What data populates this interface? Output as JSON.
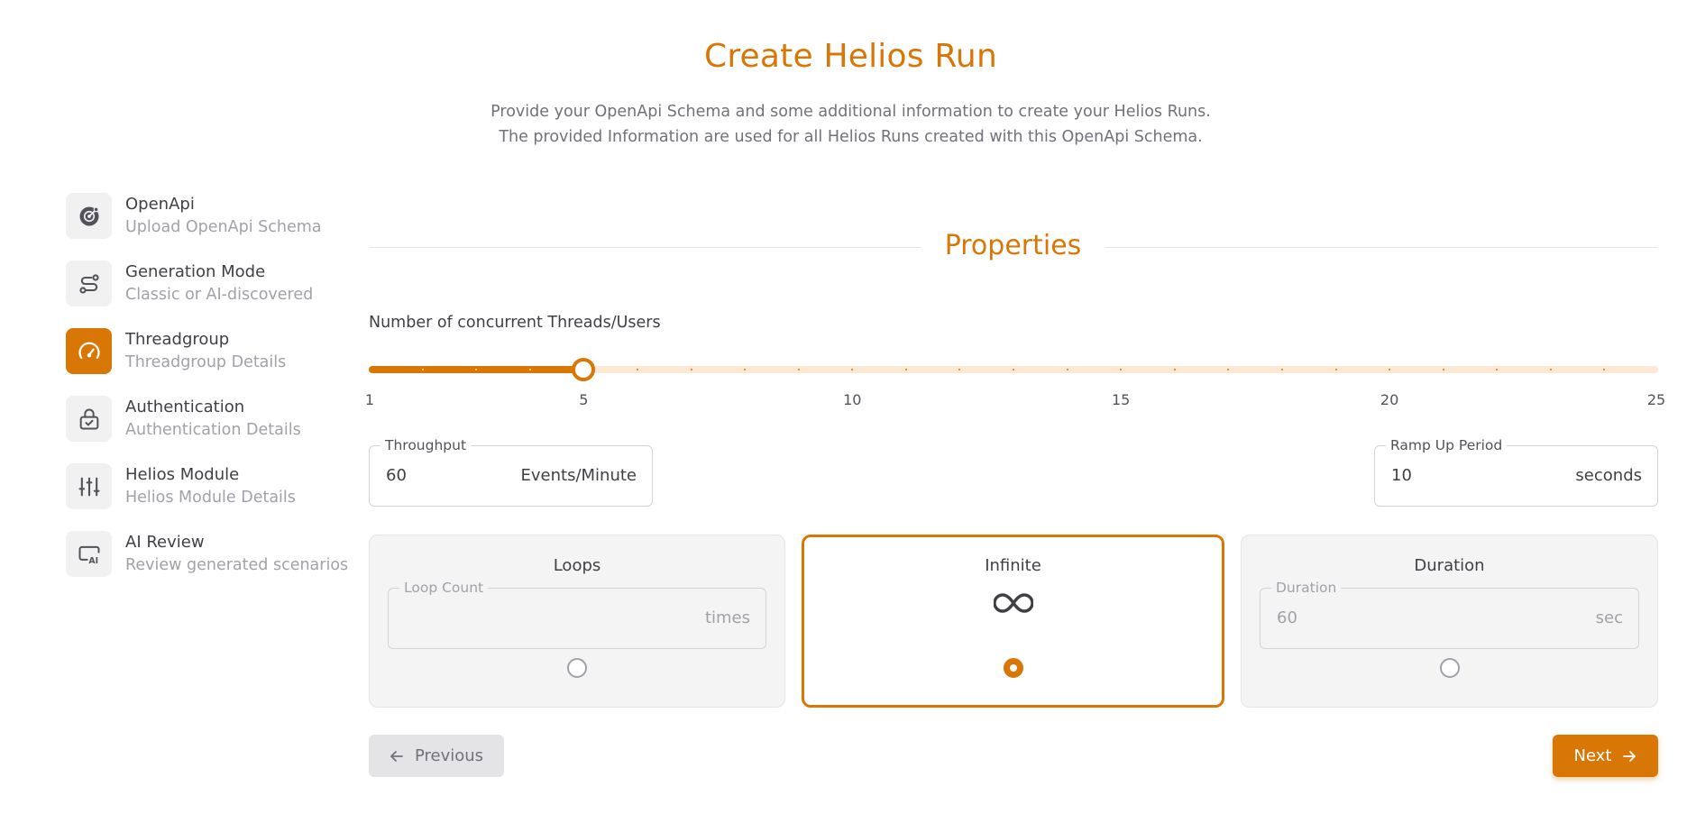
{
  "header": {
    "title": "Create Helios Run",
    "subtitle_line1": "Provide your OpenApi Schema and some additional information to create your Helios Runs.",
    "subtitle_line2": "The provided Information are used for all Helios Runs created with this OpenApi Schema."
  },
  "steps": [
    {
      "title": "OpenApi",
      "description": "Upload OpenApi Schema",
      "icon": "openapi-icon",
      "active": false
    },
    {
      "title": "Generation Mode",
      "description": "Classic or AI-discovered",
      "icon": "route-icon",
      "active": false
    },
    {
      "title": "Threadgroup",
      "description": "Threadgroup Details",
      "icon": "gauge-icon",
      "active": true
    },
    {
      "title": "Authentication",
      "description": "Authentication Details",
      "icon": "lock-check-icon",
      "active": false
    },
    {
      "title": "Helios Module",
      "description": "Helios Module Details",
      "icon": "sliders-icon",
      "active": false
    },
    {
      "title": "AI Review",
      "description": "Review generated scenarios",
      "icon": "ai-review-icon",
      "active": false
    }
  ],
  "properties": {
    "title": "Properties",
    "threads": {
      "label": "Number of concurrent Threads/Users",
      "min": 1,
      "max": 25,
      "value": 5,
      "marks": [
        "1",
        "5",
        "10",
        "15",
        "20",
        "25"
      ]
    },
    "throughput": {
      "label": "Throughput",
      "value": "60",
      "unit": "Events/Minute"
    },
    "ramp_up": {
      "label": "Ramp Up Period",
      "value": "10",
      "unit": "seconds"
    }
  },
  "modes": {
    "loops": {
      "title": "Loops",
      "field_label": "Loop Count",
      "value": "",
      "unit": "times",
      "selected": false
    },
    "infinite": {
      "title": "Infinite",
      "icon": "infinity-icon",
      "selected": true
    },
    "duration": {
      "title": "Duration",
      "field_label": "Duration",
      "value": "60",
      "unit": "sec",
      "selected": false
    }
  },
  "buttons": {
    "previous": "Previous",
    "next": "Next"
  },
  "colors": {
    "accent": "#d97706",
    "accent_light": "#fde8d4"
  }
}
